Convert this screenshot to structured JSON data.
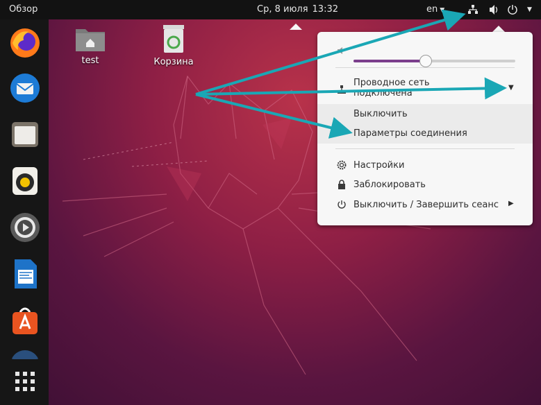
{
  "topbar": {
    "activities": "Обзор",
    "date": "Ср, 8 июля",
    "time": "13:32",
    "lang": "en"
  },
  "desktop": {
    "icons": [
      {
        "label": "test",
        "icon": "home-folder-icon"
      },
      {
        "label": "Корзина",
        "icon": "trash-icon"
      }
    ]
  },
  "dock": {
    "items": [
      "firefox-icon",
      "thunderbird-icon",
      "files-icon",
      "rhythmbox-icon",
      "software-settings-icon",
      "libreoffice-writer-icon",
      "ubuntu-software-icon",
      "show-apps-icon"
    ]
  },
  "system_menu": {
    "volume_percent": 44,
    "network_title_line1": "Проводное сеть",
    "network_title_line2": "подключена",
    "turn_off": "Выключить",
    "connection_settings": "Параметры соединения",
    "settings": "Настройки",
    "lock": "Заблокировать",
    "power_off": "Выключить / Завершить сеанс"
  },
  "colors": {
    "accent": "#7b3e8c",
    "arrow": "#1aa7b5",
    "topbar": "#121212"
  }
}
